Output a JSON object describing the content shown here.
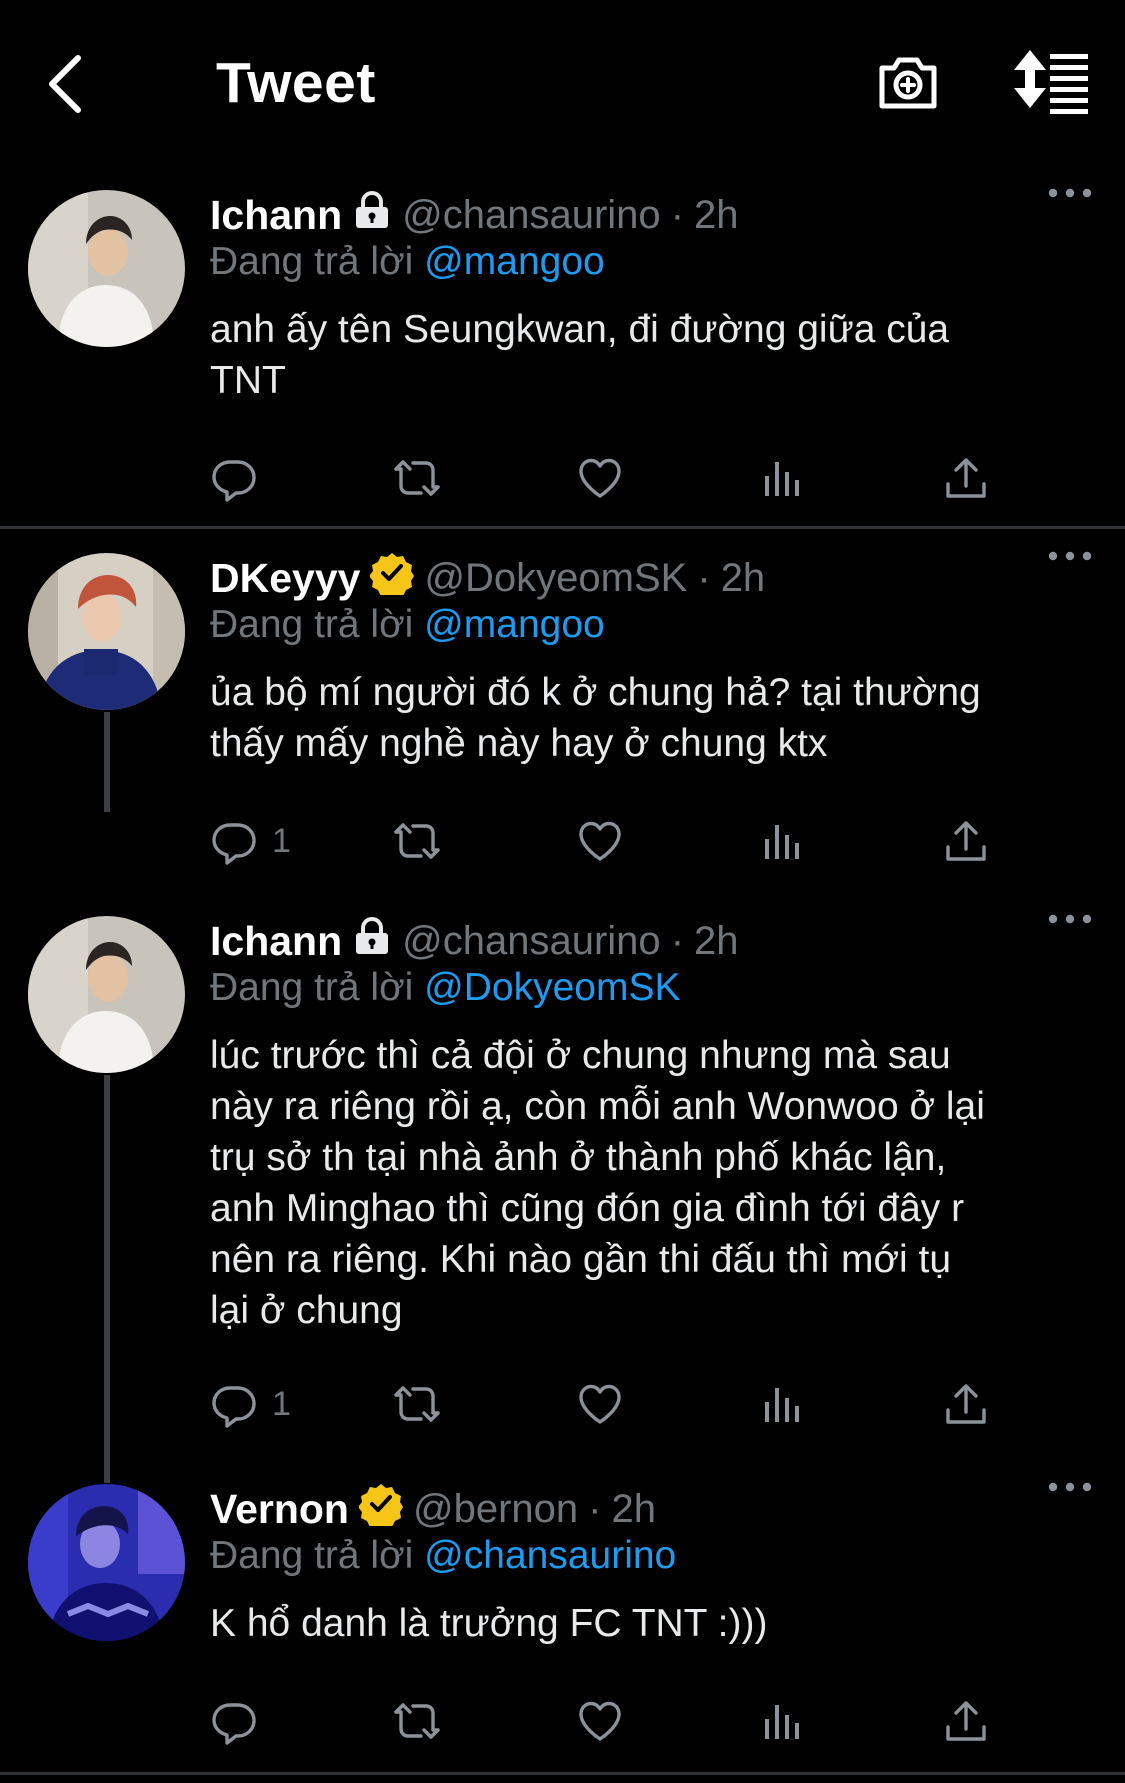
{
  "header": {
    "title": "Tweet",
    "back_icon": "chevron-left-icon",
    "camera_icon": "camera-plus-icon",
    "sort_icon": "sort-list-icon"
  },
  "labels": {
    "reply_prefix": "Đang trả lời",
    "dot": "·"
  },
  "colors": {
    "background": "#000000",
    "link": "#1d9bf0",
    "secondary_text": "#71767b",
    "verified_badge": "#f5c518"
  },
  "tweets": [
    {
      "name": "Ichann",
      "badge": "lock-icon",
      "handle": "@chansaurino",
      "time": "2h",
      "reply_to": "@mangoo",
      "text_lines": [
        "anh ấy tên Seungkwan, đi đường giữa của",
        "TNT"
      ],
      "reply_count": "",
      "avatar": "person-in-white-shirt"
    },
    {
      "name": "DKeyyy",
      "badge": "verified-icon",
      "handle": "@DokyeomSK",
      "time": "2h",
      "reply_to": "@mangoo",
      "text_lines": [
        "ủa bộ mí người đó k ở chung hả? tại thường",
        "thấy mấy nghề này hay ở chung ktx"
      ],
      "reply_count": "1",
      "avatar": "person-red-hair-blue-sweater"
    },
    {
      "name": "Ichann",
      "badge": "lock-icon",
      "handle": "@chansaurino",
      "time": "2h",
      "reply_to": "@DokyeomSK",
      "text_lines": [
        "lúc trước thì cả đội ở chung nhưng mà sau",
        "này ra riêng rồi ạ, còn mỗi anh Wonwoo ở lại",
        "trụ sở th tại nhà ảnh ở thành phố khác lận,",
        "anh Minghao thì cũng đón gia đình tới đây r",
        "nên ra riêng. Khi nào gần thi đấu thì mới tụ",
        "lại ở chung"
      ],
      "reply_count": "1",
      "avatar": "person-in-white-shirt"
    },
    {
      "name": "Vernon",
      "badge": "verified-icon",
      "handle": "@bernon",
      "time": "2h",
      "reply_to": "@chansaurino",
      "text_lines": [
        "K hổ danh là trưởng FC TNT :)))"
      ],
      "reply_count": "",
      "avatar": "person-blue-tint"
    }
  ]
}
